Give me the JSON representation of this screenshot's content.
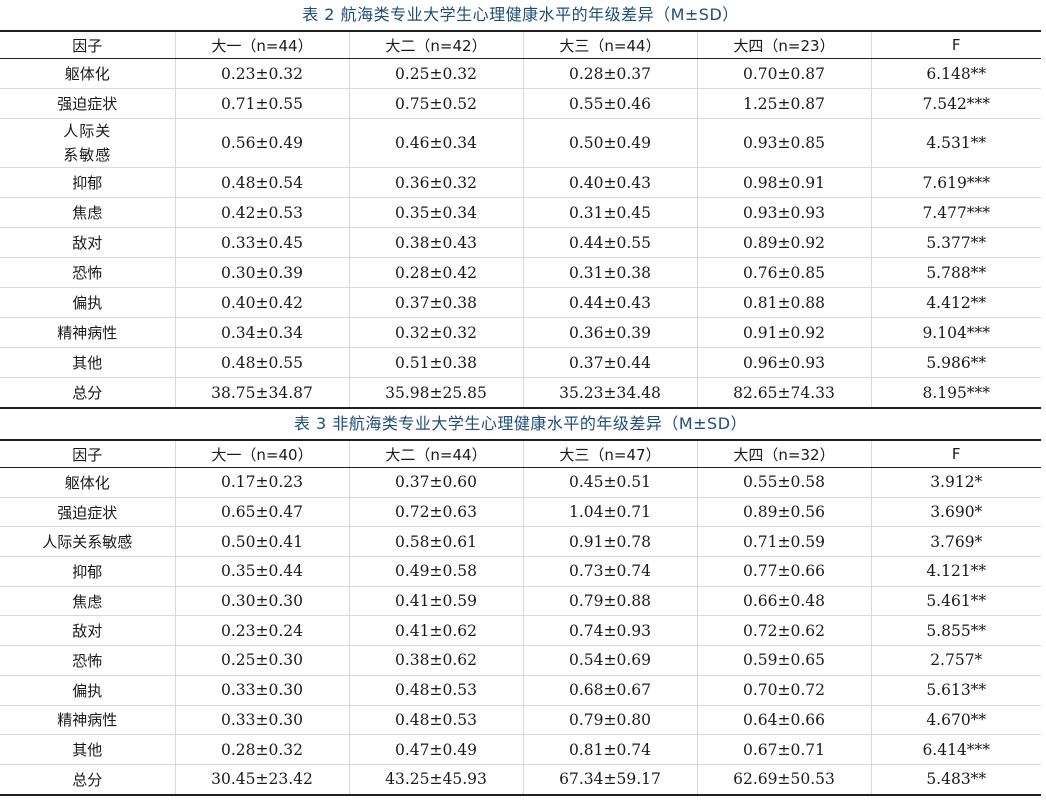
{
  "tables": [
    {
      "caption": "表 2  航海类专业大学生心理健康水平的年级差异（M±SD）",
      "headers": [
        "因子",
        "大一（n=44）",
        "大二（n=42）",
        "大三（n=44）",
        "大四（n=23）",
        "F"
      ],
      "rows": [
        [
          "躯体化",
          "0.23±0.32",
          "0.25±0.32",
          "0.28±0.37",
          "0.70±0.87",
          "6.148**"
        ],
        [
          "强迫症状",
          "0.71±0.55",
          "0.75±0.52",
          "0.55±0.46",
          "1.25±0.87",
          "7.542***"
        ],
        [
          "人际关系敏感",
          "0.56±0.49",
          "0.46±0.34",
          "0.50±0.49",
          "0.93±0.85",
          "4.531**"
        ],
        [
          "抑郁",
          "0.48±0.54",
          "0.36±0.32",
          "0.40±0.43",
          "0.98±0.91",
          "7.619***"
        ],
        [
          "焦虑",
          "0.42±0.53",
          "0.35±0.34",
          "0.31±0.45",
          "0.93±0.93",
          "7.477***"
        ],
        [
          "敌对",
          "0.33±0.45",
          "0.38±0.43",
          "0.44±0.55",
          "0.89±0.92",
          "5.377**"
        ],
        [
          "恐怖",
          "0.30±0.39",
          "0.28±0.42",
          "0.31±0.38",
          "0.76±0.85",
          "5.788**"
        ],
        [
          "偏执",
          "0.40±0.42",
          "0.37±0.38",
          "0.44±0.43",
          "0.81±0.88",
          "4.412**"
        ],
        [
          "精神病性",
          "0.34±0.34",
          "0.32±0.32",
          "0.36±0.39",
          "0.91±0.92",
          "9.104***"
        ],
        [
          "其他",
          "0.48±0.55",
          "0.51±0.38",
          "0.37±0.44",
          "0.96±0.93",
          "5.986**"
        ],
        [
          "总分",
          "38.75±34.87",
          "35.98±25.85",
          "35.23±34.48",
          "82.65±74.33",
          "8.195***"
        ]
      ]
    },
    {
      "caption": "表 3  非航海类专业大学生心理健康水平的年级差异（M±SD）",
      "headers": [
        "因子",
        "大一（n=40）",
        "大二（n=44）",
        "大三（n=47）",
        "大四（n=32）",
        "F"
      ],
      "rows": [
        [
          "躯体化",
          "0.17±0.23",
          "0.37±0.60",
          "0.45±0.51",
          "0.55±0.58",
          "3.912*"
        ],
        [
          "强迫症状",
          "0.65±0.47",
          "0.72±0.63",
          "1.04±0.71",
          "0.89±0.56",
          "3.690*"
        ],
        [
          "人际关系敏感",
          "0.50±0.41",
          "0.58±0.61",
          "0.91±0.78",
          "0.71±0.59",
          "3.769*"
        ],
        [
          "抑郁",
          "0.35±0.44",
          "0.49±0.58",
          "0.73±0.74",
          "0.77±0.66",
          "4.121**"
        ],
        [
          "焦虑",
          "0.30±0.30",
          "0.41±0.59",
          "0.79±0.88",
          "0.66±0.48",
          "5.461**"
        ],
        [
          "敌对",
          "0.23±0.24",
          "0.41±0.62",
          "0.74±0.93",
          "0.72±0.62",
          "5.855**"
        ],
        [
          "恐怖",
          "0.25±0.30",
          "0.38±0.62",
          "0.54±0.69",
          "0.59±0.65",
          "2.757*"
        ],
        [
          "偏执",
          "0.33±0.30",
          "0.48±0.53",
          "0.68±0.67",
          "0.70±0.72",
          "5.613**"
        ],
        [
          "精神病性",
          "0.33±0.30",
          "0.48±0.53",
          "0.79±0.80",
          "0.64±0.66",
          "4.670**"
        ],
        [
          "其他",
          "0.28±0.32",
          "0.47±0.49",
          "0.81±0.74",
          "0.67±0.71",
          "6.414***"
        ],
        [
          "总分",
          "30.45±23.42",
          "43.25±45.93",
          "67.34±59.17",
          "62.69±50.53",
          "5.483**"
        ]
      ]
    }
  ]
}
